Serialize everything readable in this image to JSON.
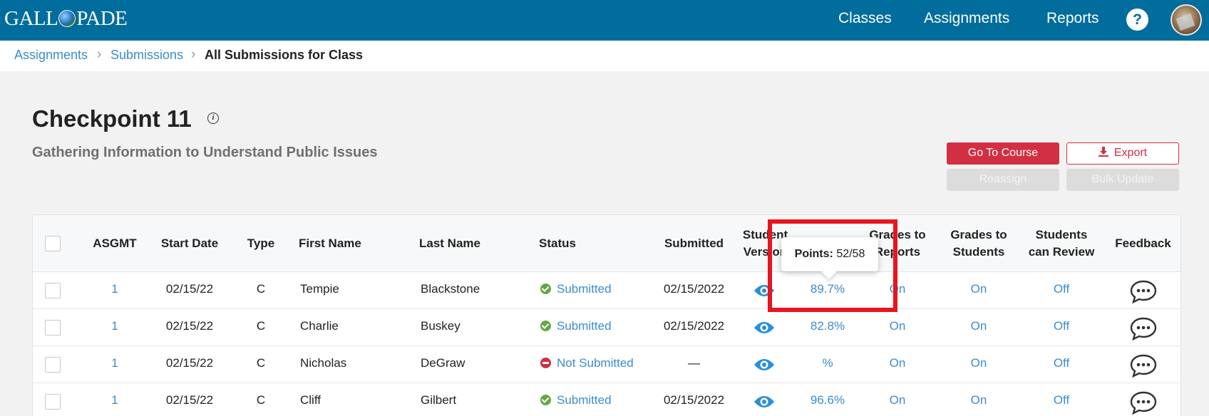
{
  "topnav": {
    "logo": "GALL PADE",
    "links": [
      "Classes",
      "Assignments",
      "Reports"
    ],
    "help": "?"
  },
  "breadcrumb": [
    "Assignments",
    "Submissions",
    "All Submissions for Class"
  ],
  "header": {
    "title": "Checkpoint 11",
    "subtitle": "Gathering Information to Understand Public Issues"
  },
  "actions": {
    "go_to_course": "Go To Course",
    "export": "Export",
    "reassign": "Reassign",
    "bulk_update": "Bulk Update"
  },
  "table": {
    "columns": [
      "ASGMT",
      "Start Date",
      "Type",
      "First Name",
      "Last Name",
      "Status",
      "Submitted",
      "Student Version",
      "",
      "Grades to Reports",
      "Grades to Students",
      "Students can Review",
      "Feedback"
    ],
    "rows": [
      {
        "asgmt": "1",
        "start": "02/15/22",
        "type": "C",
        "first": "Tempie",
        "last": "Blackstone",
        "status": "Submitted",
        "status_kind": "ok",
        "submitted": "02/15/2022",
        "score": "89.7%",
        "to_reports": "On",
        "to_students": "On",
        "review": "Off"
      },
      {
        "asgmt": "1",
        "start": "02/15/22",
        "type": "C",
        "first": "Charlie",
        "last": "Buskey",
        "status": "Submitted",
        "status_kind": "ok",
        "submitted": "02/15/2022",
        "score": "82.8%",
        "to_reports": "On",
        "to_students": "On",
        "review": "Off"
      },
      {
        "asgmt": "1",
        "start": "02/15/22",
        "type": "C",
        "first": "Nicholas",
        "last": "DeGraw",
        "status": "Not Submitted",
        "status_kind": "no",
        "submitted": "—",
        "score": "%",
        "to_reports": "On",
        "to_students": "On",
        "review": "Off"
      },
      {
        "asgmt": "1",
        "start": "02/15/22",
        "type": "C",
        "first": "Cliff",
        "last": "Gilbert",
        "status": "Submitted",
        "status_kind": "ok",
        "submitted": "02/15/2022",
        "score": "96.6%",
        "to_reports": "On",
        "to_students": "On",
        "review": "Off"
      }
    ]
  },
  "tooltip": {
    "label": "Points:",
    "value": "52/58"
  },
  "colors": {
    "nav": "#006d9c",
    "link": "#3a8ccc",
    "accent": "#d22f43",
    "highlight": "#e8141e"
  }
}
